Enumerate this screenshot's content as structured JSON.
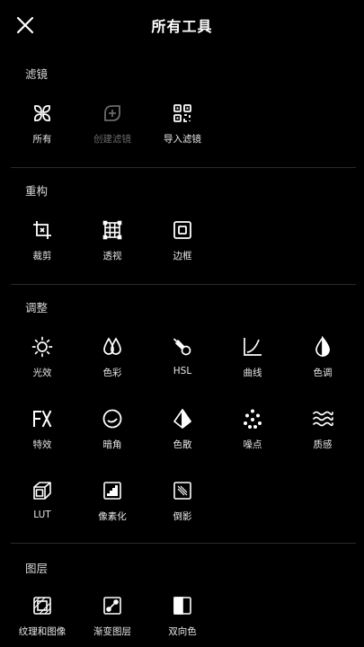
{
  "header": {
    "title": "所有工具",
    "close_icon": "close-icon"
  },
  "sections": {
    "filters": {
      "label": "滤镜",
      "items": [
        {
          "label": "所有",
          "icon": "grid-petal-icon"
        },
        {
          "label": "创建滤镜",
          "icon": "add-leaf-icon",
          "disabled": true
        },
        {
          "label": "导入滤镜",
          "icon": "qr-scan-icon"
        }
      ]
    },
    "reframe": {
      "label": "重构",
      "items": [
        {
          "label": "裁剪",
          "icon": "crop-icon"
        },
        {
          "label": "透视",
          "icon": "perspective-grid-icon"
        },
        {
          "label": "边框",
          "icon": "border-frame-icon"
        }
      ]
    },
    "adjust": {
      "label": "调整",
      "items": [
        {
          "label": "光效",
          "icon": "sun-icon"
        },
        {
          "label": "色彩",
          "icon": "drops-icon"
        },
        {
          "label": "HSL",
          "icon": "hsl-comet-icon"
        },
        {
          "label": "曲线",
          "icon": "curve-icon"
        },
        {
          "label": "色调",
          "icon": "half-drop-icon"
        },
        {
          "label": "特效",
          "icon": "fx-icon"
        },
        {
          "label": "暗角",
          "icon": "vignette-icon"
        },
        {
          "label": "色散",
          "icon": "prism-icon"
        },
        {
          "label": "噪点",
          "icon": "noise-dots-icon"
        },
        {
          "label": "质感",
          "icon": "waves-icon"
        },
        {
          "label": "LUT",
          "icon": "lut-cube-icon"
        },
        {
          "label": "像素化",
          "icon": "pixelate-icon"
        },
        {
          "label": "倒影",
          "icon": "reflection-icon"
        }
      ]
    },
    "layers": {
      "label": "图层",
      "items": [
        {
          "label": "纹理和图像",
          "icon": "texture-image-icon"
        },
        {
          "label": "渐变图层",
          "icon": "gradient-layer-icon"
        },
        {
          "label": "双向色",
          "icon": "duotone-icon"
        }
      ]
    }
  },
  "colors": {
    "background": "#000000",
    "text": "#ffffff",
    "disabled": "#6a6a6a",
    "divider": "#2a2a2a"
  }
}
